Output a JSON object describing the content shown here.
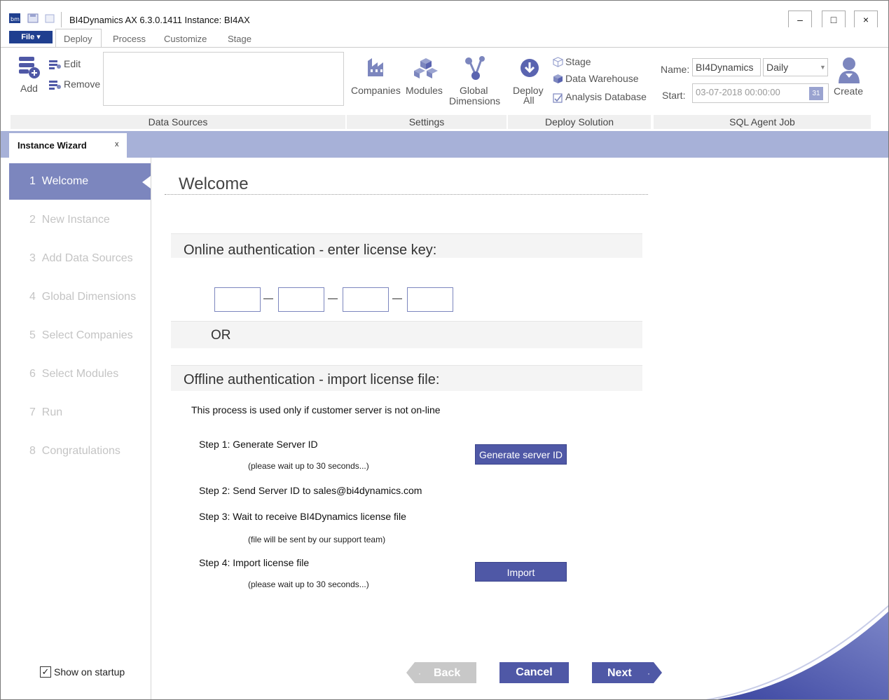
{
  "window": {
    "title": "BI4Dynamics AX 6.3.0.1411  Instance: BI4AX",
    "controls": {
      "minimize": "–",
      "maximize": "□",
      "close": "×"
    }
  },
  "menu": {
    "file_label": "File ▾",
    "tabs": [
      "Deploy",
      "Process",
      "Customize",
      "Stage"
    ]
  },
  "ribbon": {
    "data_sources": {
      "add": "Add",
      "edit": "Edit",
      "remove": "Remove",
      "group": "Data Sources"
    },
    "settings": {
      "companies": "Companies",
      "modules": "Modules",
      "global_dim_1": "Global",
      "global_dim_2": "Dimensions",
      "group": "Settings"
    },
    "deploy_solution": {
      "deploy_1": "Deploy",
      "deploy_2": "All",
      "stage": "Stage",
      "data_warehouse": "Data Warehouse",
      "analysis_db": "Analysis Database",
      "group": "Deploy Solution"
    },
    "sql_agent_job": {
      "name_label": "Name:",
      "name_value": "BI4Dynamics",
      "schedule_value": "Daily",
      "start_label": "Start:",
      "start_value": "03-07-2018 00:00:00",
      "calendar_day": "31",
      "create": "Create",
      "group": "SQL Agent Job"
    }
  },
  "doc_tab": {
    "label": "Instance Wizard",
    "close": "x"
  },
  "sidebar": {
    "steps": [
      {
        "num": "1",
        "label": "Welcome"
      },
      {
        "num": "2",
        "label": "New Instance"
      },
      {
        "num": "3",
        "label": "Add Data Sources"
      },
      {
        "num": "4",
        "label": "Global Dimensions"
      },
      {
        "num": "5",
        "label": "Select Companies"
      },
      {
        "num": "6",
        "label": "Select Modules"
      },
      {
        "num": "7",
        "label": "Run"
      },
      {
        "num": "8",
        "label": "Congratulations"
      }
    ],
    "show_on_startup": "Show on startup",
    "show_on_startup_checked": true
  },
  "main": {
    "title": "Welcome",
    "online_heading": "Online authentication - enter license key:",
    "or_label": "OR",
    "offline_heading": "Offline authentication - import license file:",
    "offline_desc": "This process is used only if customer server is not on-line",
    "step1": "Step 1: Generate Server ID",
    "step1_note": "(please wait up to 30 seconds...)",
    "generate_btn": "Generate server ID",
    "step2": "Step 2: Send Server ID to sales@bi4dynamics.com",
    "step3": "Step 3: Wait to receive BI4Dynamics license file",
    "step3_note": "(file will be sent by our support team)",
    "step4": "Step 4: Import license file",
    "step4_note": "(please wait up to 30 seconds...)",
    "import_btn": "Import"
  },
  "nav": {
    "back": "Back",
    "cancel": "Cancel",
    "next": "Next"
  },
  "colors": {
    "accent": "#4f58a6",
    "strip": "#a7b1d8",
    "active_step": "#7c86be",
    "file_btn": "#1f3f8f"
  }
}
